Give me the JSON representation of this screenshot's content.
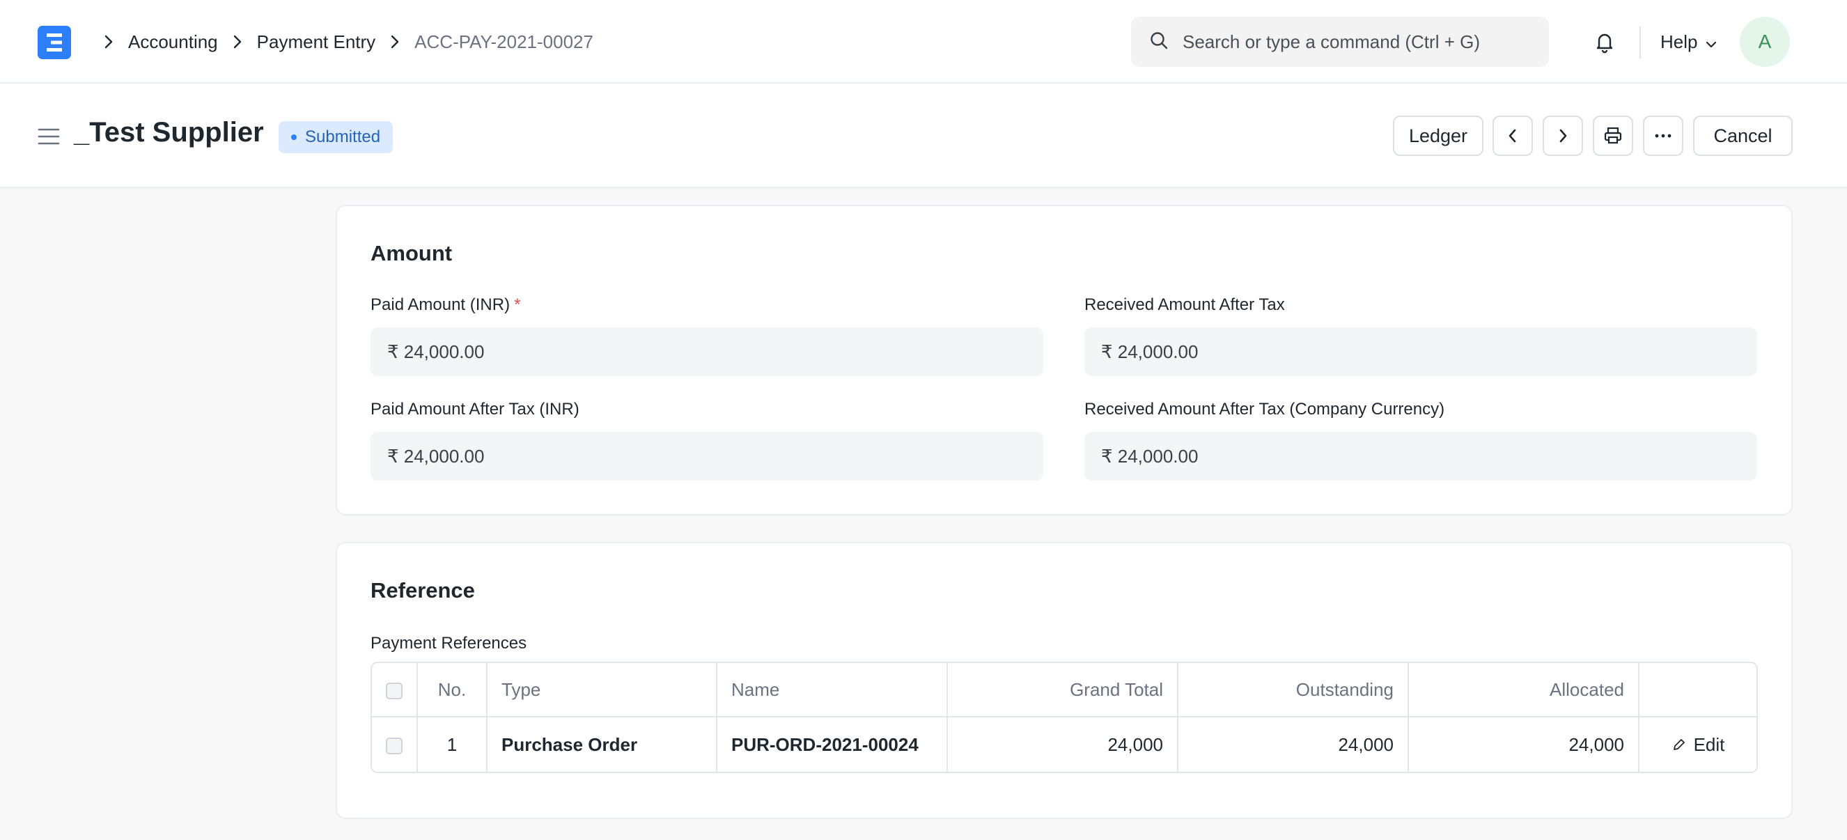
{
  "navbar": {
    "logo_letter": "E",
    "breadcrumbs": [
      "Accounting",
      "Payment Entry",
      "ACC-PAY-2021-00027"
    ],
    "search_placeholder": "Search or type a command (Ctrl + G)",
    "help_label": "Help",
    "avatar_initial": "A"
  },
  "page_head": {
    "title": "_Test Supplier",
    "status": "Submitted",
    "buttons": {
      "ledger": "Ledger",
      "cancel": "Cancel"
    }
  },
  "amount_section": {
    "title": "Amount",
    "fields": {
      "paid_amount": {
        "label": "Paid Amount (INR)",
        "required_mark": "*",
        "value": "₹ 24,000.00"
      },
      "received_after_tax": {
        "label": "Received Amount After Tax",
        "value": "₹ 24,000.00"
      },
      "paid_after_tax": {
        "label": "Paid Amount After Tax (INR)",
        "value": "₹ 24,000.00"
      },
      "received_after_tax_company": {
        "label": "Received Amount After Tax (Company Currency)",
        "value": "₹ 24,000.00"
      }
    }
  },
  "reference_section": {
    "title": "Reference",
    "table_label": "Payment References",
    "columns": {
      "no": "No.",
      "type": "Type",
      "name": "Name",
      "grand_total": "Grand Total",
      "outstanding": "Outstanding",
      "allocated": "Allocated"
    },
    "rows": [
      {
        "no": "1",
        "type": "Purchase Order",
        "name": "PUR-ORD-2021-00024",
        "grand_total": "24,000",
        "outstanding": "24,000",
        "allocated": "24,000",
        "edit_label": "Edit"
      }
    ]
  },
  "colors": {
    "brand": "#2d7ff9",
    "status_bg": "#dbeafe",
    "status_text": "#2563ba",
    "required": "#e24c4c"
  }
}
